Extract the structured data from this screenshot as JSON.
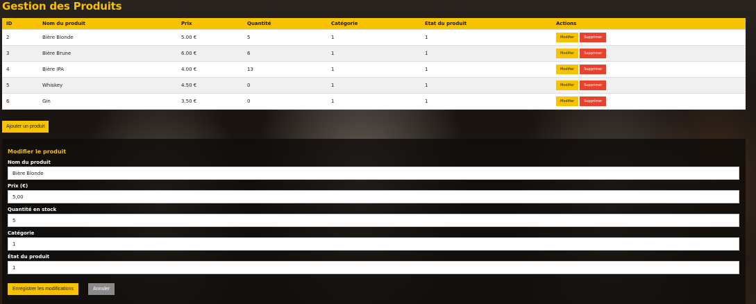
{
  "page": {
    "title": "Gestion des Produits"
  },
  "table": {
    "headers": [
      "ID",
      "Nom du produit",
      "Prix",
      "Quantité",
      "Catégorie",
      "Etat du produit",
      "Actions"
    ],
    "rows": [
      {
        "id": "2",
        "name": "Bière Blonde",
        "price": "5.00 €",
        "qty": "5",
        "cat": "1",
        "state": "1"
      },
      {
        "id": "3",
        "name": "Bière Brune",
        "price": "6.00 €",
        "qty": "6",
        "cat": "1",
        "state": "1"
      },
      {
        "id": "4",
        "name": "Bière IPA",
        "price": "4.00 €",
        "qty": "13",
        "cat": "1",
        "state": "1"
      },
      {
        "id": "5",
        "name": "Whiskey",
        "price": "4.50 €",
        "qty": "0",
        "cat": "1",
        "state": "1"
      },
      {
        "id": "6",
        "name": "Gin",
        "price": "3.50 €",
        "qty": "0",
        "cat": "1",
        "state": "1"
      }
    ],
    "edit_label": "Modifier",
    "delete_label": "Supprimer"
  },
  "add_button": "Ajouter un produit",
  "form": {
    "title": "Modifier le produit",
    "name_label": "Nom du produit",
    "name_value": "Bière Blonde",
    "price_label": "Prix (€)",
    "price_value": "5,00",
    "qty_label": "Quantité en stock",
    "qty_value": "5",
    "cat_label": "Catégorie",
    "cat_value": "1",
    "state_label": "État du produit",
    "state_value": "1",
    "save_label": "Enregistrer les modifications",
    "cancel_label": "Annuler"
  },
  "colors": {
    "accent": "#f7c300",
    "danger": "#e9412b",
    "cancel": "#8a8a8a"
  }
}
